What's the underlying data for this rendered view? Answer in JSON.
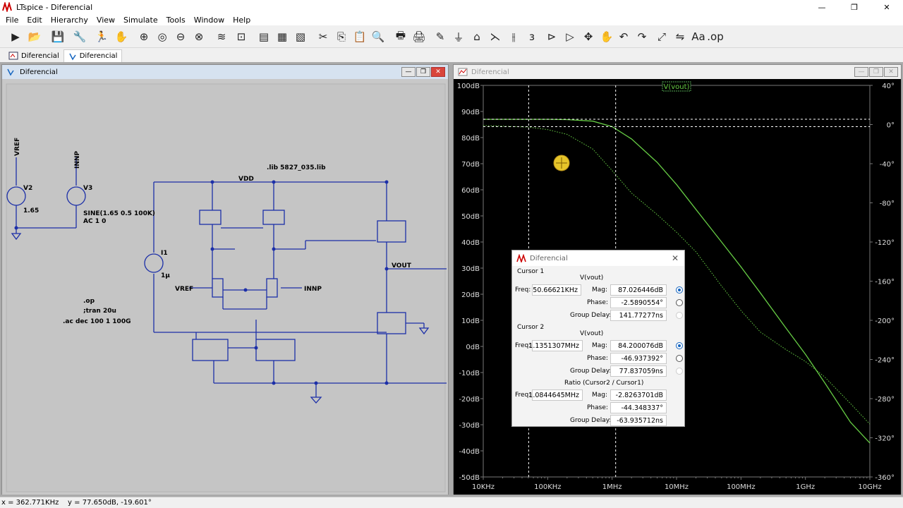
{
  "window": {
    "title": "LTspice - Diferencial",
    "minimize": "—",
    "maximize": "❐",
    "close": "✕"
  },
  "menu": [
    "File",
    "Edit",
    "Hierarchy",
    "View",
    "Simulate",
    "Tools",
    "Window",
    "Help"
  ],
  "toolbar_icons": [
    "run-icon",
    "open-icon",
    "save-icon",
    "control-panel-icon",
    "run-walk-icon",
    "pan-hand-icon",
    "zoom-in-icon",
    "zoom-area-icon",
    "zoom-out-icon",
    "zoom-cancel-icon",
    "autorange-icon",
    "mark-icon",
    "tile-horizontal-icon",
    "cascade-icon",
    "tile-vertical-icon",
    "cut-icon",
    "copy-icon",
    "paste-icon",
    "find-icon",
    "print-icon",
    "print-preview-icon",
    "pencil-icon",
    "ground-icon",
    "label-icon",
    "resistor-icon",
    "capacitor-icon",
    "inductor-icon",
    "diode-icon",
    "component-icon",
    "move-icon",
    "drag-icon",
    "undo-icon",
    "redo-icon",
    "rotate-icon",
    "mirror-icon",
    "text-icon",
    "spice-directive-icon"
  ],
  "toolbar_text": {
    "text": "Aa",
    "op": ".op"
  },
  "tabs": [
    {
      "label": "Diferencial"
    },
    {
      "label": "Diferencial"
    }
  ],
  "schematic": {
    "title": "Diferencial",
    "labels": {
      "vref_top": "VREF",
      "innp_top": "INNP",
      "v2": "V2",
      "v2_val": "1.65",
      "v3": "V3",
      "v3_val1": "SINE(1.65 0.5 100K)",
      "v3_val2": "AC 1 0",
      "lib": ".lib 5827_035.lib",
      "vdd": "VDD",
      "i1": "I1",
      "i1_val": "1µ",
      "vref": "VREF",
      "innp": "INNP",
      "vout": "VOUT",
      "op": ".op",
      "tran": ";tran 20u",
      "ac": ".ac dec 100 1 100G"
    }
  },
  "plot": {
    "title": "Diferencial",
    "trace_label": "V(vout)",
    "colors": {
      "background": "#000000",
      "trace": "#66cc44",
      "grid": "#777777",
      "cursor": "#ffffff"
    },
    "chart_data": {
      "type": "line",
      "x_scale": "log",
      "xlabel": "",
      "ylabel": "",
      "x_ticks": [
        "10KHz",
        "100KHz",
        "1MHz",
        "10MHz",
        "100MHz",
        "1GHz",
        "10GHz"
      ],
      "y_left_ticks": [
        "100dB",
        "90dB",
        "80dB",
        "70dB",
        "60dB",
        "50dB",
        "40dB",
        "30dB",
        "20dB",
        "10dB",
        "0dB",
        "-10dB",
        "-20dB",
        "-30dB",
        "-40dB",
        "-50dB"
      ],
      "y_right_ticks": [
        "40°",
        "0°",
        "-40°",
        "-80°",
        "-120°",
        "-160°",
        "-200°",
        "-240°",
        "-280°",
        "-320°",
        "-360°"
      ],
      "y_left_range": [
        -50,
        100
      ],
      "y_right_range": [
        -360,
        40
      ],
      "series": [
        {
          "name": "magnitude",
          "unit": "dB",
          "x": [
            10000,
            50000,
            100000,
            200000,
            500000,
            1000000,
            2000000,
            5000000,
            10000000,
            20000000,
            50000000,
            100000000,
            200000000,
            500000000,
            1000000000,
            2000000000,
            5000000000,
            10000000000
          ],
          "y": [
            87.0,
            87.0,
            87.0,
            86.9,
            86.3,
            84.2,
            79.5,
            70.5,
            62.0,
            52.5,
            40.0,
            30.5,
            20.5,
            7.0,
            -3.0,
            -14.0,
            -29.0,
            -37.0
          ]
        },
        {
          "name": "phase",
          "unit": "°",
          "style": "dotted",
          "x": [
            10000,
            50000,
            100000,
            200000,
            500000,
            1000000,
            2000000,
            5000000,
            10000000,
            20000000,
            50000000,
            100000000,
            200000000,
            500000000,
            1000000000,
            2000000000,
            5000000000,
            10000000000
          ],
          "y": [
            -1,
            -2.6,
            -5.2,
            -10,
            -25,
            -47,
            -70,
            -92,
            -110,
            -130,
            -165,
            -190,
            -212,
            -230,
            -242,
            -258,
            -285,
            -306
          ]
        }
      ],
      "cursors": [
        {
          "name": "Cursor 1",
          "x": 50666.21,
          "y": 87.026446
        },
        {
          "name": "Cursor 2",
          "x": 1135130.7,
          "y": 84.200076
        }
      ]
    }
  },
  "cursor_dialog": {
    "title": "Diferencial",
    "c1": {
      "heading": "Cursor 1",
      "trace": "V(vout)",
      "freq_label": "Freq:",
      "freq": "50.66621KHz",
      "mag_label": "Mag:",
      "mag": "87.026446dB",
      "phase_label": "Phase:",
      "phase": "-2.5890554°",
      "gd_label": "Group Delay:",
      "gd": "141.77277ns"
    },
    "c2": {
      "heading": "Cursor 2",
      "trace": "V(vout)",
      "freq_label": "Freq:",
      "freq": "1.1351307MHz",
      "mag_label": "Mag:",
      "mag": "84.200076dB",
      "phase_label": "Phase:",
      "phase": "-46.937392°",
      "gd_label": "Group Delay:",
      "gd": "77.837059ns"
    },
    "ratio": {
      "heading": "Ratio (Cursor2 / Cursor1)",
      "freq_label": "Freq:",
      "freq": "1.0844645MHz",
      "mag_label": "Mag:",
      "mag": "-2.8263701dB",
      "phase_label": "Phase:",
      "phase": "-44.348337°",
      "gd_label": "Group Delay:",
      "gd": "-63.935712ns"
    }
  },
  "status": "x = 362.771KHz    y = 77.650dB, -19.601°"
}
